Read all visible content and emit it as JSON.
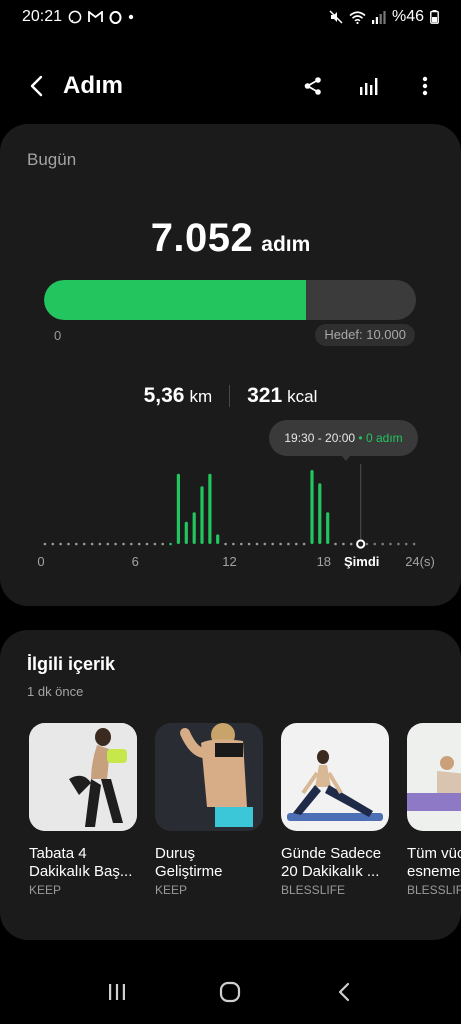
{
  "status_bar": {
    "time": "20:21",
    "battery": "%46"
  },
  "app_bar": {
    "title": "Adım"
  },
  "today": {
    "label": "Bugün",
    "steps": "7.052",
    "steps_unit": "adım",
    "progress_fraction": 0.7052,
    "progress_min": "0",
    "goal": "Hedef: 10.000",
    "distance_value": "5,36",
    "distance_unit": "km",
    "calories_value": "321",
    "calories_unit": "kcal",
    "tooltip_range": "19:30 - 20:00",
    "tooltip_separator": "•",
    "tooltip_value": "0 adım"
  },
  "chart_data": {
    "type": "bar",
    "x_ticks": [
      "0",
      "6",
      "12",
      "18",
      "Şimdi",
      "24(s)"
    ],
    "bin_minutes": 30,
    "values_relative": [
      0,
      0,
      0,
      0,
      0,
      0,
      0,
      0,
      0,
      0,
      0,
      0,
      0,
      0,
      0,
      0,
      0.03,
      0.95,
      0.3,
      0.43,
      0.78,
      0.95,
      0.13,
      0,
      0,
      0,
      0,
      0,
      0,
      0,
      0,
      0,
      0,
      0,
      1.0,
      0.82,
      0.43,
      0,
      0,
      0,
      0,
      0,
      0.03,
      0,
      0,
      0,
      0,
      0
    ],
    "accent": "#22c55e"
  },
  "related": {
    "title": "İlgili içerik",
    "time": "1 dk önce",
    "items": [
      {
        "title": "Tabata 4 Dakikalık Baş...",
        "source": "KEEP"
      },
      {
        "title": "Duruş Geliştirme",
        "source": "KEEP"
      },
      {
        "title": "Günde Sadece 20 Dakikalık ...",
        "source": "BLESSLIFE"
      },
      {
        "title": "Tüm vücu esneme",
        "source": "BLESSLIFE"
      }
    ]
  },
  "icons": {
    "back": "back-icon",
    "share": "share-icon",
    "chart": "chart-icon",
    "more": "more-icon"
  }
}
